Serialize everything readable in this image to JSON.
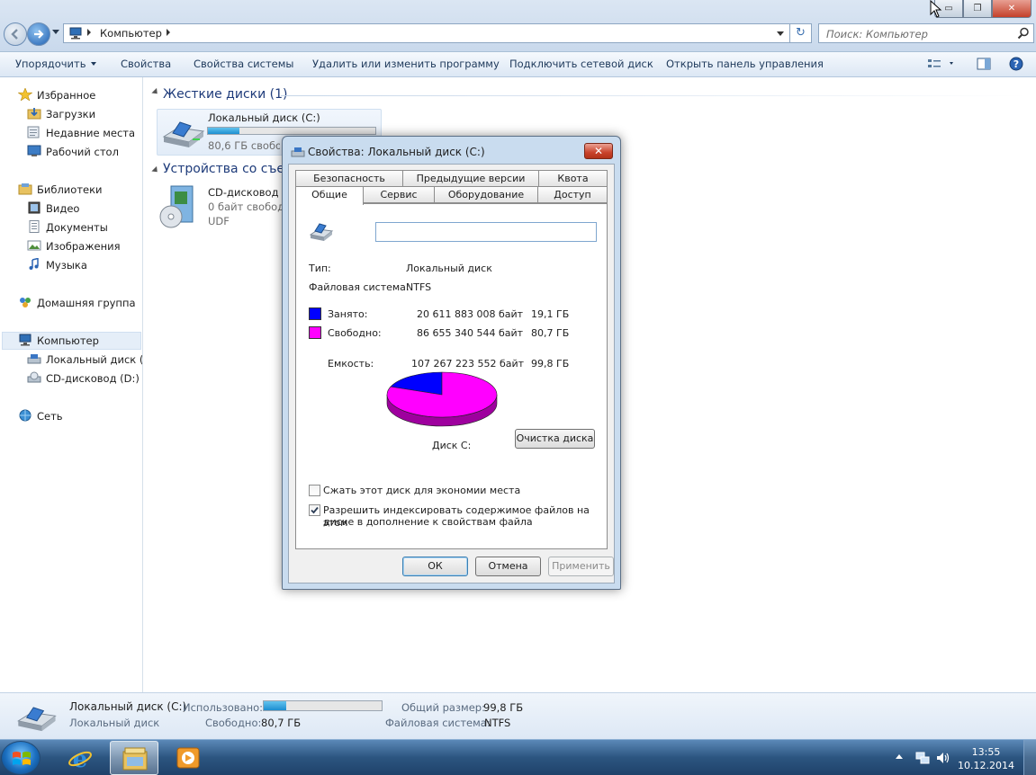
{
  "window": {
    "address_crumb": "Компьютер",
    "search_placeholder": "Поиск: Компьютер",
    "minimize": "▭",
    "maximize": "❐",
    "close": "✕"
  },
  "toolbar": {
    "organize": "Упорядочить",
    "properties": "Свойства",
    "system_properties": "Свойства системы",
    "uninstall": "Удалить или изменить программу",
    "map_drive": "Подключить сетевой диск",
    "control_panel": "Открыть панель управления"
  },
  "sidebar": {
    "favorites": "Избранное",
    "downloads": "Загрузки",
    "recent": "Недавние места",
    "desktop": "Рабочий стол",
    "libraries": "Библиотеки",
    "video": "Видео",
    "documents": "Документы",
    "images": "Изображения",
    "music": "Музыка",
    "homegroup": "Домашняя группа",
    "computer": "Компьютер",
    "local_disk": "Локальный диск (С",
    "cd_drive": "CD-дисковод (D:) D",
    "network": "Сеть"
  },
  "content": {
    "hdd_group": "Жесткие диски (1)",
    "removable_group": "Устройства со съем",
    "local_disk_name": "Локальный диск (C:)",
    "local_disk_free": "80,6 ГБ свободн",
    "local_disk_used_fraction": 0.19,
    "cd_name": "CD-дисковод (D",
    "cd_free": "0 байт свободн",
    "cd_fs": "UDF"
  },
  "details": {
    "name": "Локальный диск (C:)",
    "type": "Локальный диск",
    "used_label": "Использовано:",
    "used_fraction": 0.19,
    "free_label": "Свободно:",
    "free_value": "80,7 ГБ",
    "total_label": "Общий размер:",
    "total_value": "99,8 ГБ",
    "fs_label": "Файловая система:",
    "fs_value": "NTFS"
  },
  "dialog": {
    "title": "Свойства: Локальный диск (C:)",
    "close": "✕",
    "tabs_row1": [
      "Безопасность",
      "Предыдущие версии",
      "Квота"
    ],
    "tabs_row2": [
      "Общие",
      "Сервис",
      "Оборудование",
      "Доступ"
    ],
    "name_value": "",
    "type_label": "Тип:",
    "type_value": "Локальный диск",
    "fs_label": "Файловая система:",
    "fs_value": "NTFS",
    "used_label": "Занято:",
    "used_bytes": "20 611 883 008 байт",
    "used_gb": "19,1 ГБ",
    "free_label": "Свободно:",
    "free_bytes": "86 655 340 544 байт",
    "free_gb": "80,7 ГБ",
    "capacity_label": "Емкость:",
    "capacity_bytes": "107 267 223 552 байт",
    "capacity_gb": "99,8 ГБ",
    "disk_label": "Диск C:",
    "cleanup": "Очистка диска",
    "compress": "Сжать этот диск для экономии места",
    "index_line1": "Разрешить индексировать содержимое файлов на этом",
    "index_line2": "диске в дополнение к свойствам файла",
    "compress_checked": false,
    "index_checked": true,
    "ok": "ОК",
    "cancel": "Отмена",
    "apply": "Применить",
    "used_color": "#0000ff",
    "free_color": "#ff00ff"
  },
  "chart_data": {
    "type": "pie",
    "categories": [
      "Занято",
      "Свободно"
    ],
    "values": [
      20611883008,
      86655340544
    ],
    "colors": [
      "#0000ff",
      "#ff00ff"
    ]
  },
  "taskbar": {
    "time": "13:55",
    "date": "10.12.2014"
  }
}
